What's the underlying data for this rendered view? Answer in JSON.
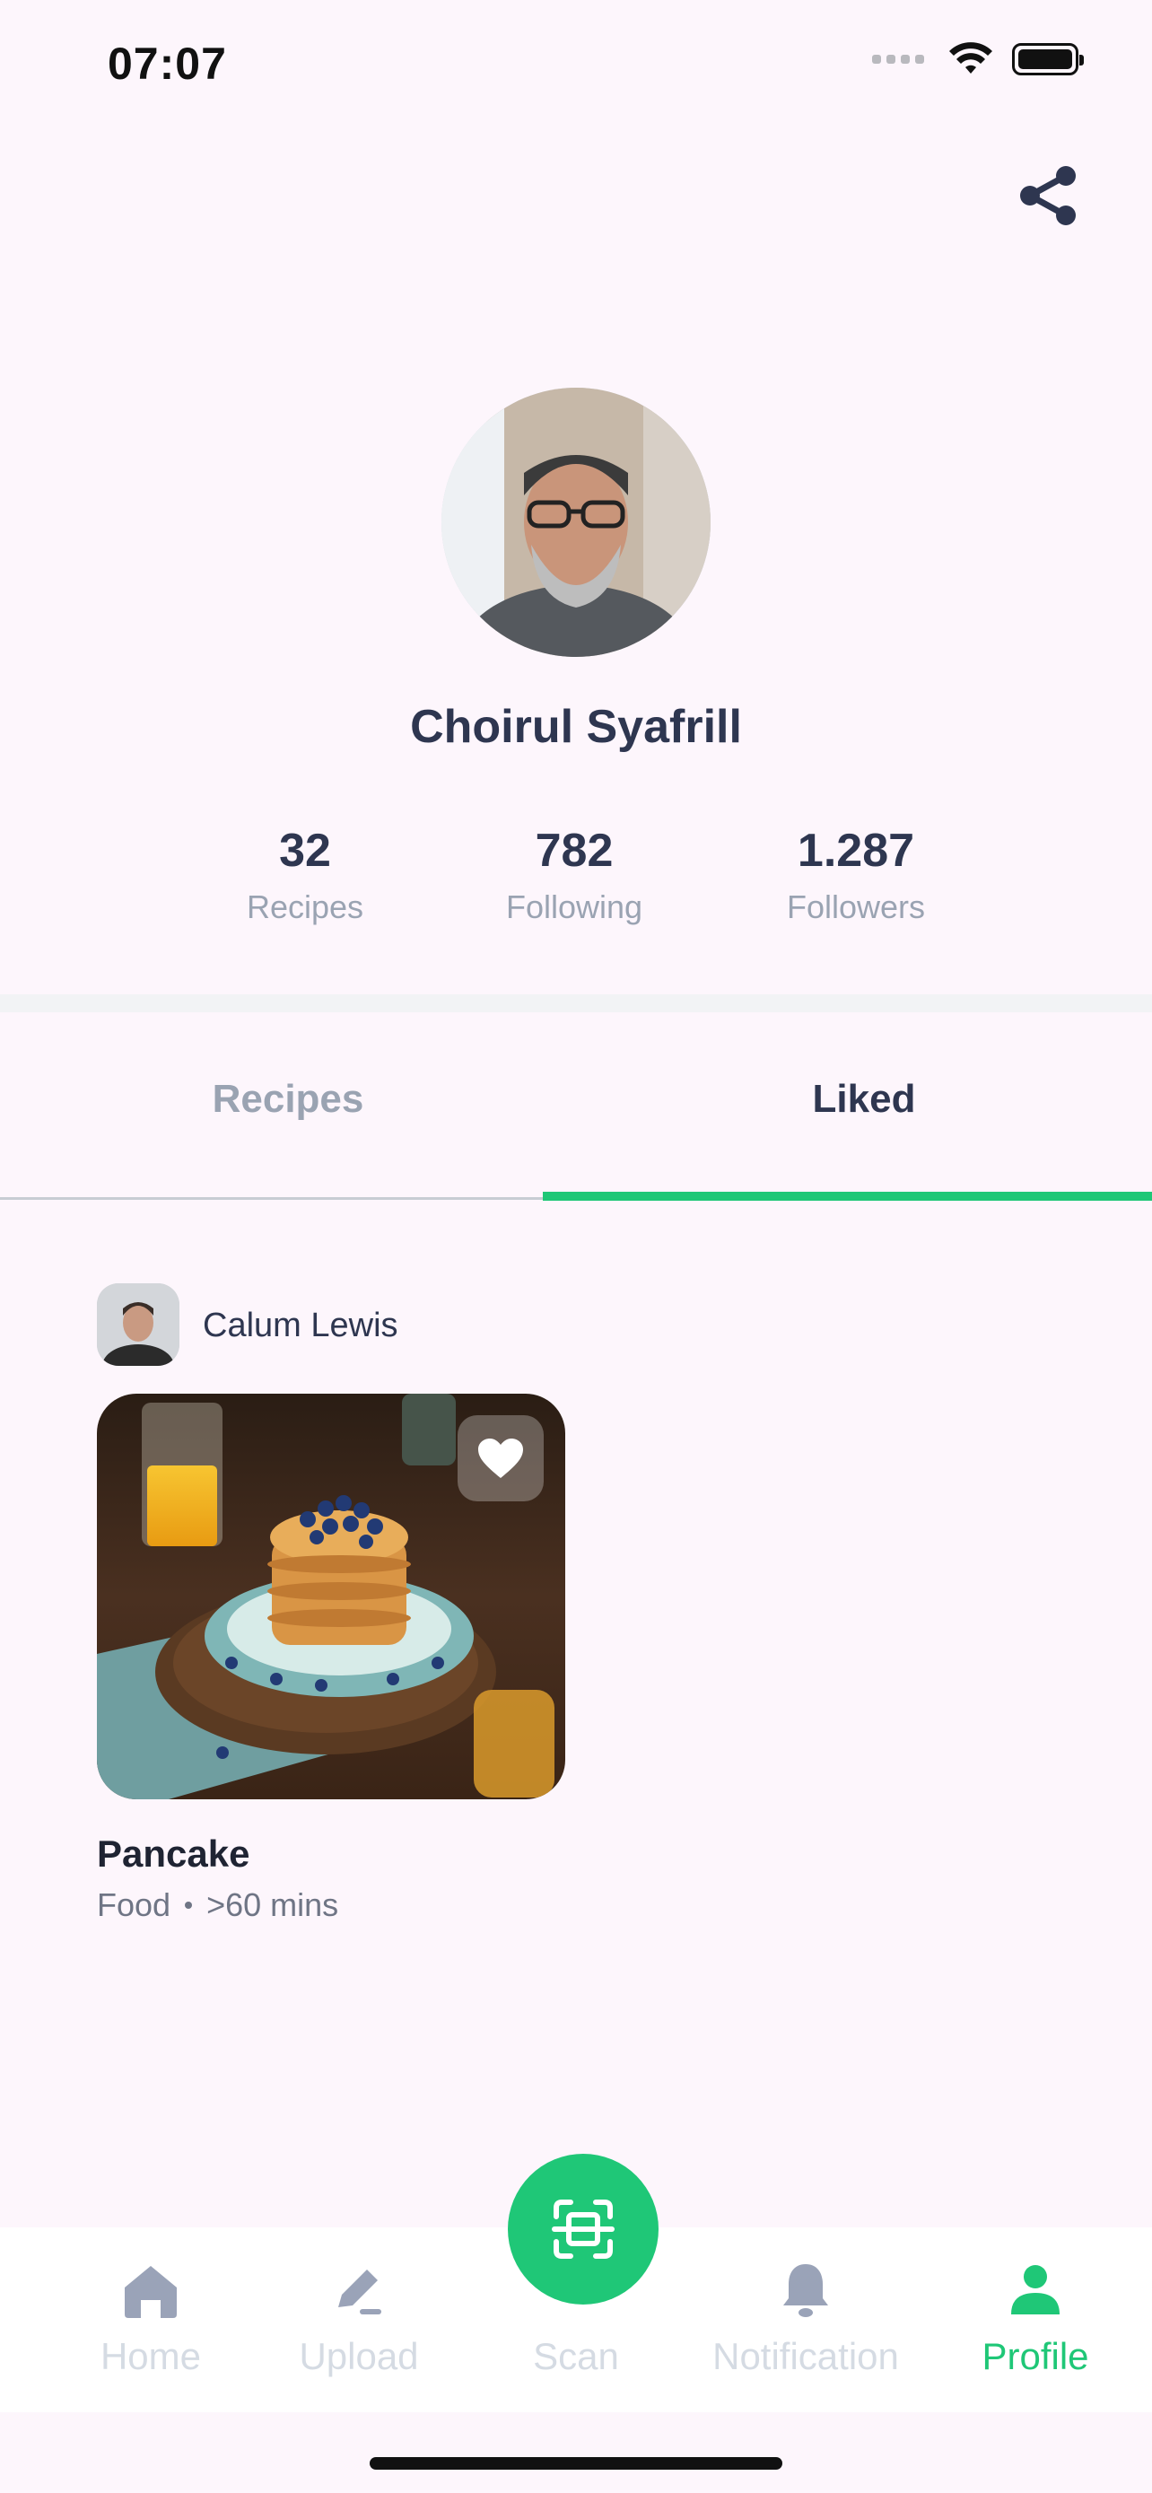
{
  "status_bar": {
    "time": "07:07"
  },
  "profile": {
    "name": "Choirul Syafrill",
    "stats": [
      {
        "value": "32",
        "label": "Recipes"
      },
      {
        "value": "782",
        "label": "Following"
      },
      {
        "value": "1.287",
        "label": "Followers"
      }
    ]
  },
  "tabs": {
    "recipes": "Recipes",
    "liked": "Liked",
    "active": "Liked"
  },
  "liked_item": {
    "author": "Calum Lewis",
    "title": "Pancake",
    "category": "Food",
    "duration": ">60 mins",
    "liked": true
  },
  "bottom_nav": {
    "home": "Home",
    "upload": "Upload",
    "scan": "Scan",
    "notification": "Notification",
    "profile": "Profile",
    "active": "Profile"
  },
  "colors": {
    "accent": "#1fc777",
    "text_dark": "#2e3650",
    "text_muted": "#9aa3b2",
    "background": "#fdf6fc"
  }
}
